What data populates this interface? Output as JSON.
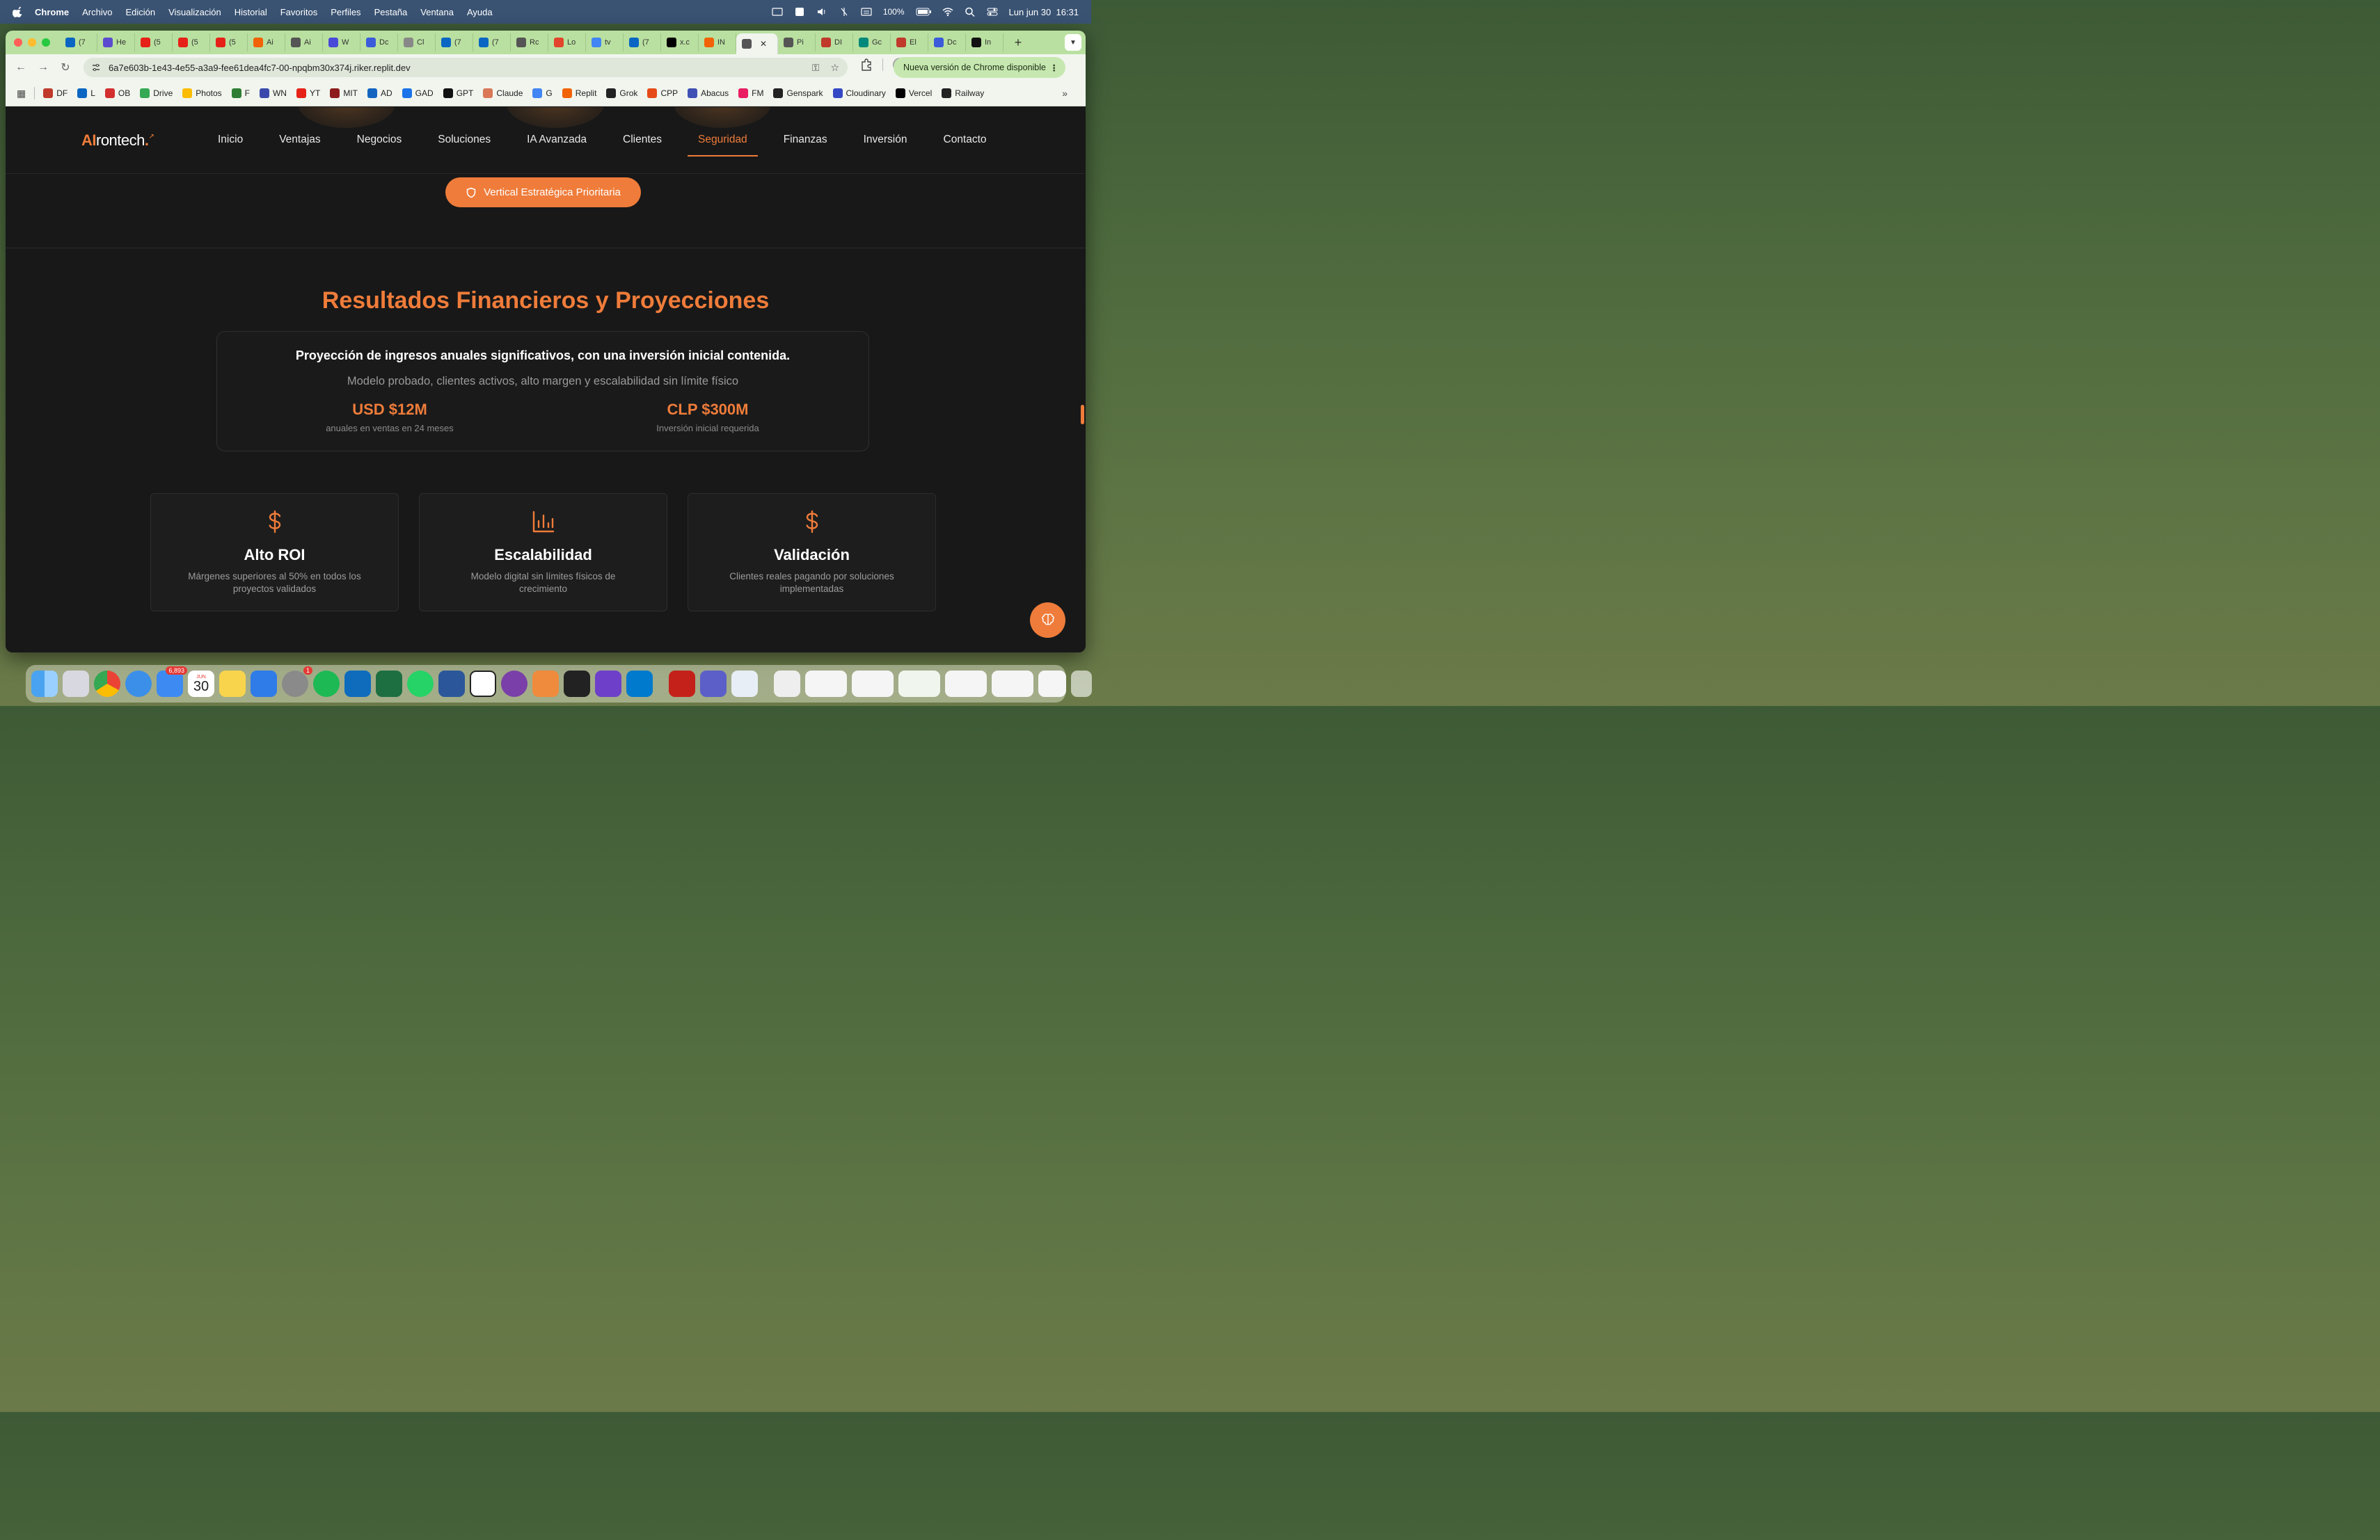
{
  "menubar": {
    "app_name": "Chrome",
    "items": [
      "Archivo",
      "Edición",
      "Visualización",
      "Historial",
      "Favoritos",
      "Perfiles",
      "Pestaña",
      "Ventana",
      "Ayuda"
    ],
    "battery": "100%",
    "datetime": "Lun jun 30  16:31"
  },
  "tabs": [
    {
      "label": "(7",
      "icon": "linkedin-icon",
      "color": "#0a66c2"
    },
    {
      "label": "He",
      "icon": "video-icon",
      "color": "#5b4ccf"
    },
    {
      "label": "(5",
      "icon": "youtube-icon",
      "color": "#e62117"
    },
    {
      "label": "(5",
      "icon": "youtube-icon",
      "color": "#e62117"
    },
    {
      "label": "(5",
      "icon": "youtube-icon",
      "color": "#e62117"
    },
    {
      "label": "Ai",
      "icon": "replit-icon",
      "color": "#f26207"
    },
    {
      "label": "Ai",
      "icon": "globe-icon",
      "color": "#555555"
    },
    {
      "label": "W",
      "icon": "triangle-icon",
      "color": "#4a4ad8"
    },
    {
      "label": "Dc",
      "icon": "chart-icon",
      "color": "#3b5bdb"
    },
    {
      "label": "Cl",
      "icon": "sparkle-icon",
      "color": "#888888"
    },
    {
      "label": "(7",
      "icon": "linkedin-icon",
      "color": "#0a66c2"
    },
    {
      "label": "(7",
      "icon": "linkedin-icon",
      "color": "#0a66c2"
    },
    {
      "label": "Rc",
      "icon": "globe-icon",
      "color": "#555555"
    },
    {
      "label": "Lo",
      "icon": "bolt-icon",
      "color": "#e2452b"
    },
    {
      "label": "tv",
      "icon": "google-icon",
      "color": "#4285f4"
    },
    {
      "label": "(7",
      "icon": "linkedin-icon",
      "color": "#0a66c2"
    },
    {
      "label": "x.c",
      "icon": "x-icon",
      "color": "#000000"
    },
    {
      "label": "IN",
      "icon": "replit-icon",
      "color": "#f26207"
    },
    {
      "label": "",
      "icon": "globe-icon",
      "color": "#555555",
      "active": true
    },
    {
      "label": "Pi",
      "icon": "globe-icon",
      "color": "#555555"
    },
    {
      "label": "DI",
      "icon": "df-icon",
      "color": "#c0392b"
    },
    {
      "label": "Gc",
      "icon": "meet-icon",
      "color": "#00897b"
    },
    {
      "label": "El",
      "icon": "df-icon",
      "color": "#c0392b"
    },
    {
      "label": "Dc",
      "icon": "chart-icon",
      "color": "#3b5bdb"
    },
    {
      "label": "In",
      "icon": "openai-icon",
      "color": "#111111"
    }
  ],
  "toolbar": {
    "url": "6a7e603b-1e43-4e55-a3a9-fee61dea4fc7-00-npqbm30x374j.riker.replit.dev",
    "update_label": "Nueva versión de Chrome disponible"
  },
  "bookmarks": [
    {
      "label": "DF",
      "color": "#c0392b"
    },
    {
      "label": "L",
      "color": "#0a66c2"
    },
    {
      "label": "OB",
      "color": "#d32f2f"
    },
    {
      "label": "Drive",
      "color": "#34a853"
    },
    {
      "label": "Photos",
      "color": "#fbbc04"
    },
    {
      "label": "F",
      "color": "#2e7d32"
    },
    {
      "label": "WN",
      "color": "#3949ab"
    },
    {
      "label": "YT",
      "color": "#e62117"
    },
    {
      "label": "MIT",
      "color": "#8e1b1b"
    },
    {
      "label": "AD",
      "color": "#1565c0"
    },
    {
      "label": "GAD",
      "color": "#1a73e8"
    },
    {
      "label": "GPT",
      "color": "#111111"
    },
    {
      "label": "Claude",
      "color": "#d97757"
    },
    {
      "label": "G",
      "color": "#4285f4"
    },
    {
      "label": "Replit",
      "color": "#f26207"
    },
    {
      "label": "Grok",
      "color": "#222222"
    },
    {
      "label": "CPP",
      "color": "#e64a19"
    },
    {
      "label": "Abacus",
      "color": "#3f51b5"
    },
    {
      "label": "FM",
      "color": "#e91e63"
    },
    {
      "label": "Genspark",
      "color": "#222222"
    },
    {
      "label": "Cloudinary",
      "color": "#3448c5"
    },
    {
      "label": "Vercel",
      "color": "#000000"
    },
    {
      "label": "Railway",
      "color": "#222222"
    }
  ],
  "site": {
    "logo_ai": "AI",
    "logo_rest": "rontech",
    "logo_suffix": ".",
    "nav": [
      "Inicio",
      "Ventajas",
      "Negocios",
      "Soluciones",
      "IA Avanzada",
      "Clientes",
      "Seguridad",
      "Finanzas",
      "Inversión",
      "Contacto"
    ],
    "active_nav": "Seguridad",
    "cta": "Vertical Estratégica Prioritaria",
    "section_title": "Resultados Financieros y Proyecciones",
    "summary": {
      "headline": "Proyección de ingresos anuales significativos, con una inversión inicial contenida.",
      "sub": "Modelo probado, clientes activos, alto margen y escalabilidad sin límite físico",
      "metrics": [
        {
          "value": "USD $12M",
          "label": "anuales en ventas en 24 meses"
        },
        {
          "value": "CLP $300M",
          "label": "Inversión inicial requerida"
        }
      ]
    },
    "features": [
      {
        "icon": "dollar-icon",
        "title": "Alto ROI",
        "desc": "Márgenes superiores al 50% en todos los proyectos validados"
      },
      {
        "icon": "bar-chart-icon",
        "title": "Escalabilidad",
        "desc": "Modelo digital sin límites físicos de crecimiento"
      },
      {
        "icon": "dollar-icon",
        "title": "Validación",
        "desc": "Clientes reales pagando por soluciones implementadas"
      }
    ],
    "accent_color": "#ef7c3a"
  },
  "dock": {
    "mail_badge": "6,893",
    "calendar_month": "JUN",
    "calendar_day": "30",
    "settings_badge": "1",
    "apps": [
      "finder-icon",
      "launchpad-icon",
      "chrome-icon",
      "safari-icon",
      "mail-icon",
      "calendar-icon",
      "notes-icon",
      "keynote-icon",
      "settings-icon",
      "spotify-icon",
      "outlook-icon",
      "excel-icon",
      "whatsapp-icon",
      "word-icon",
      "calendar31-icon",
      "circle-app-icon",
      "phone-mirror-icon",
      "replit-icon",
      "github-icon",
      "vscode-icon",
      "acrobat-icon",
      "teams-icon",
      "preview-icon"
    ]
  }
}
